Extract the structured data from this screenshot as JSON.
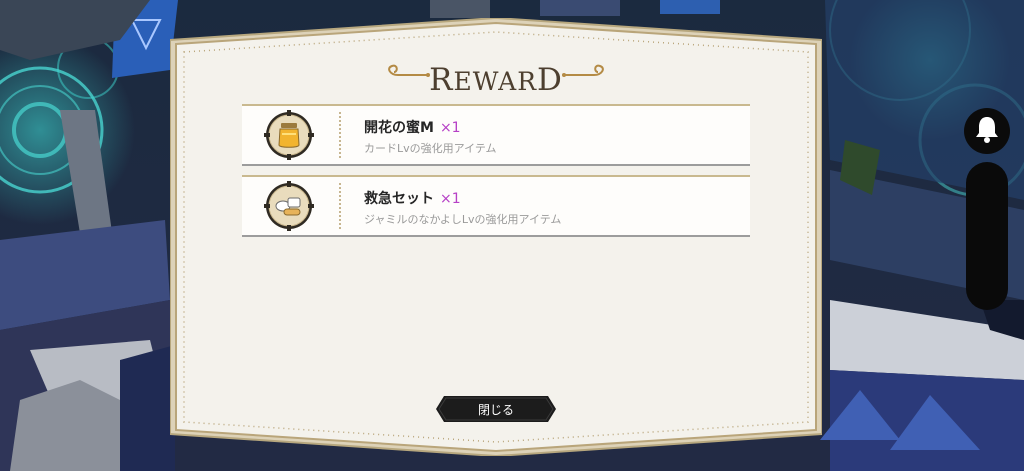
{
  "dialog": {
    "title": "REWARD",
    "close_label": "閉じる"
  },
  "rewards": [
    {
      "name": "開花の蜜M",
      "quantity": "×1",
      "description": "カードLvの強化用アイテム",
      "icon": "honey-jar-icon"
    },
    {
      "name": "救急セット",
      "quantity": "×1",
      "description": "ジャミルのなかよしLvの強化用アイテム",
      "icon": "first-aid-kit-icon"
    }
  ],
  "side_controls": {
    "bell_icon": "bell-icon"
  },
  "colors": {
    "panel_bg": "#f4f2ec",
    "frame_gold": "#b9a57a",
    "quantity_accent": "#b640c6",
    "title_brown": "#4d3f2f",
    "button_bg": "#1c1c1c"
  }
}
